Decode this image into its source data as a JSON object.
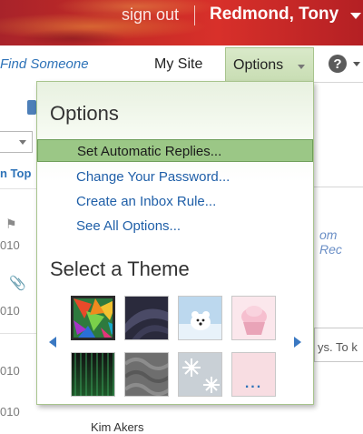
{
  "header": {
    "sign_out": "sign out",
    "user_name": "Redmond, Tony"
  },
  "nav": {
    "find_someone": "Find Someone",
    "my_site": "My Site",
    "options": "Options",
    "help_glyph": "?"
  },
  "background": {
    "top_link": "n Top",
    "dates": [
      "010",
      "010",
      "010",
      "010"
    ],
    "right_link": "om Rec",
    "right_text": "ys. To k",
    "bottom_text": "Kim Akers"
  },
  "options_menu": {
    "title": "Options",
    "items": [
      {
        "label": "Set Automatic Replies...",
        "highlighted": true
      },
      {
        "label": "Change Your Password..."
      },
      {
        "label": "Create an Inbox Rule..."
      },
      {
        "label": "See All Options..."
      }
    ],
    "theme_title": "Select a Theme",
    "themes": [
      "color-burst",
      "dark-swirl",
      "polar-bear",
      "cupcake",
      "green-stripes",
      "gray-waves",
      "snowflakes",
      "pink-blank"
    ],
    "selected_theme": "color-burst",
    "more_label": "..."
  },
  "colors": {
    "header_red": "#c62b26",
    "options_green": "#c8ddb3",
    "highlight_green": "#9bc786",
    "link_blue": "#1f5fa8"
  }
}
